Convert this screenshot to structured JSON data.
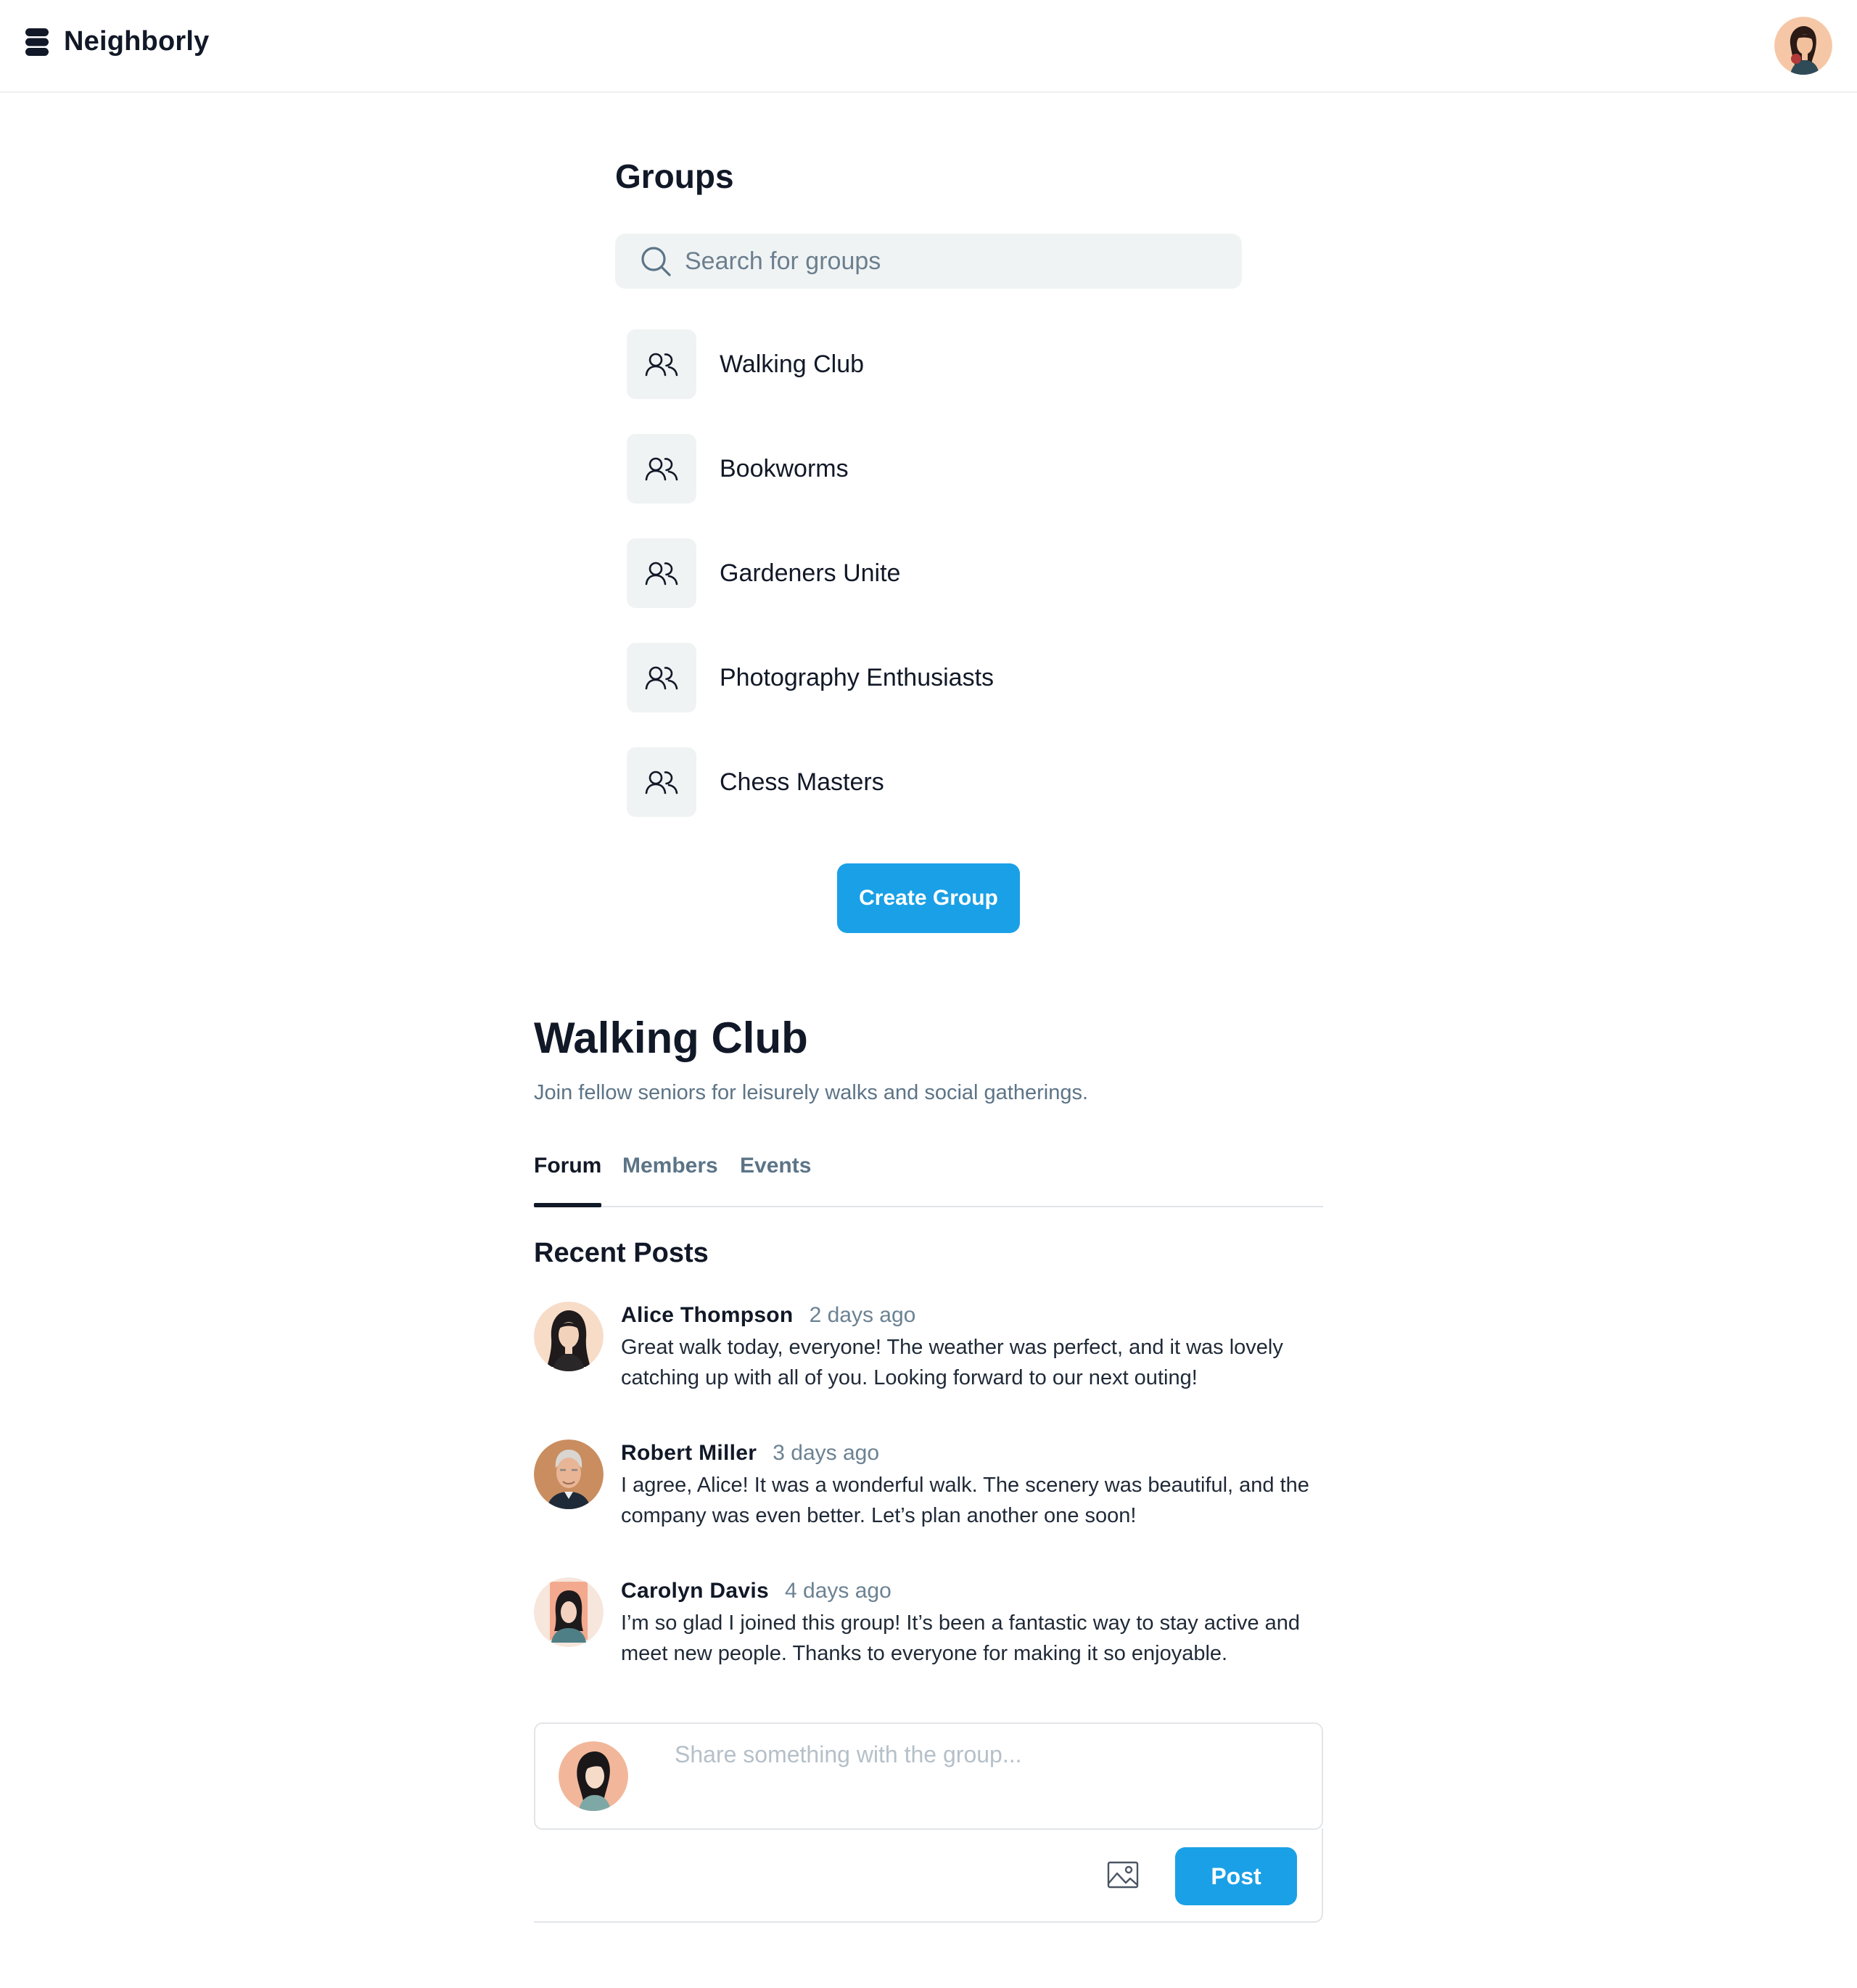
{
  "app": {
    "name": "Neighborly"
  },
  "groups": {
    "title": "Groups",
    "search_placeholder": "Search for groups",
    "items": [
      {
        "label": "Walking Club"
      },
      {
        "label": "Bookworms"
      },
      {
        "label": "Gardeners Unite"
      },
      {
        "label": "Photography Enthusiasts"
      },
      {
        "label": "Chess Masters"
      }
    ],
    "create_label": "Create Group"
  },
  "club": {
    "title": "Walking Club",
    "description": "Join fellow seniors for leisurely walks and social gatherings.",
    "tabs": [
      "Forum",
      "Members",
      "Events"
    ],
    "active_tab": "Forum",
    "recent_title": "Recent Posts",
    "posts": [
      {
        "author": "Alice Thompson",
        "time": "2 days ago",
        "body": "Great walk today, everyone! The weather was perfect, and it was lovely catching up with all of you. Looking forward to our next outing!"
      },
      {
        "author": "Robert Miller",
        "time": "3 days ago",
        "body": "I agree, Alice! It was a wonderful walk. The scenery was beautiful, and the company was even better. Let’s plan another one soon!"
      },
      {
        "author": "Carolyn Davis",
        "time": "4 days ago",
        "body": "I’m so glad I joined this group! It’s been a fantastic way to stay active and meet new people. Thanks to everyone for making it so enjoyable."
      }
    ]
  },
  "composer": {
    "placeholder": "Share something with the group...",
    "post_label": "Post"
  },
  "icons": {
    "brand": "stacked-layers-icon",
    "search": "search-icon",
    "group": "users-icon",
    "attach": "image-icon"
  },
  "colors": {
    "accent": "#1aa0e6",
    "muted_text": "#5c7487",
    "tile_bg": "#f0f3f4"
  }
}
